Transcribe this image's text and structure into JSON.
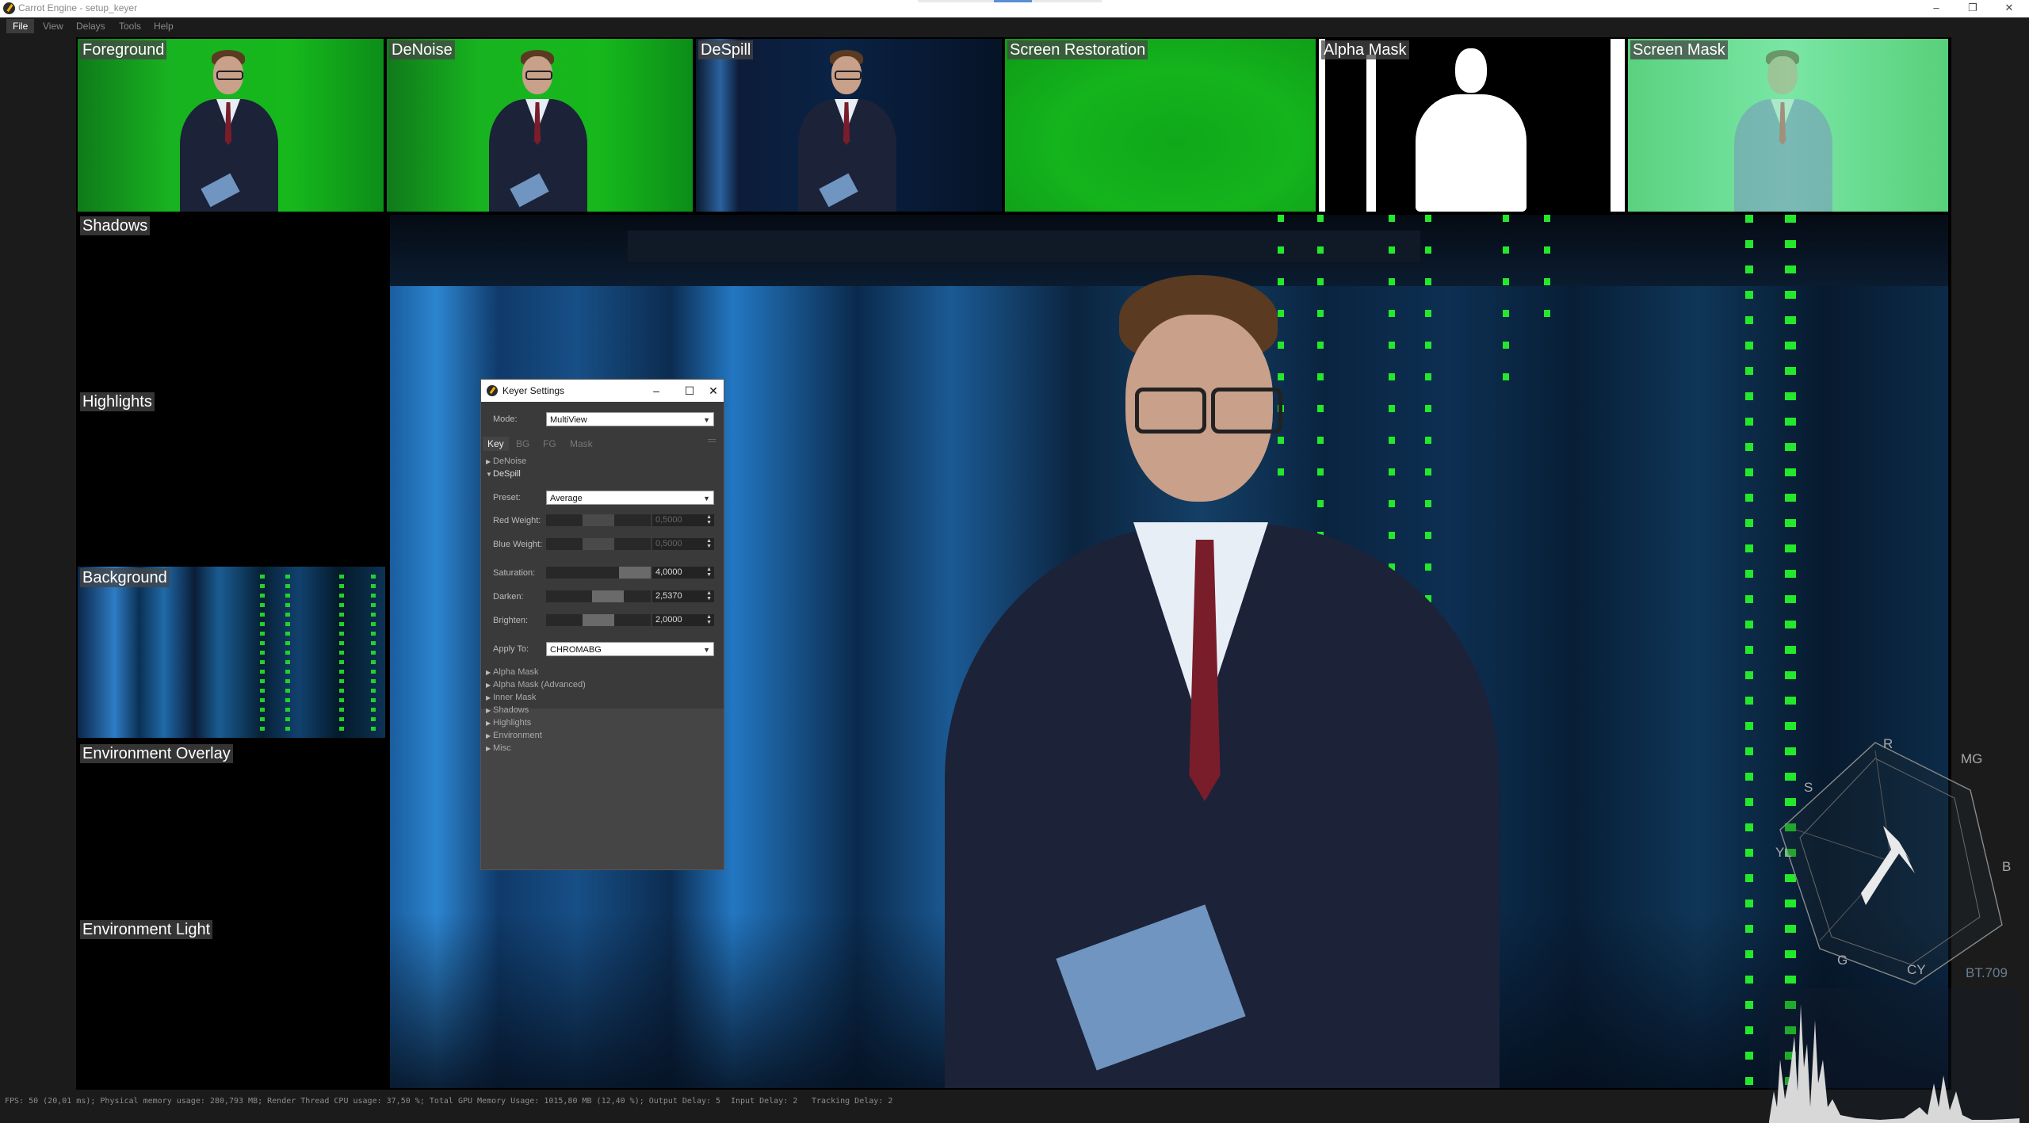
{
  "window": {
    "title": "Carrot Engine - setup_keyer",
    "controls": [
      "–",
      "❐",
      "✕"
    ]
  },
  "menubar": [
    "File",
    "View",
    "Delays",
    "Tools",
    "Help"
  ],
  "panels": {
    "foreground": "Foreground",
    "denoise": "DeNoise",
    "despill": "DeSpill",
    "screen_restoration": "Screen Restoration",
    "alpha_mask": "Alpha Mask",
    "screen_mask": "Screen Mask",
    "shadows": "Shadows",
    "highlights": "Highlights",
    "background": "Background",
    "environment_overlay": "Environment Overlay",
    "environment_light": "Environment Light"
  },
  "dialog": {
    "title": "Keyer Settings",
    "mode_label": "Mode:",
    "mode_value": "MultiView",
    "tabs": [
      "Key",
      "BG",
      "FG",
      "Mask"
    ],
    "tree_top": [
      "DeNoise",
      "DeSpill"
    ],
    "preset_label": "Preset:",
    "preset_value": "Average",
    "params": [
      {
        "label": "Red Weight:",
        "value": "0,5000",
        "fraction": 0.5,
        "enabled": false
      },
      {
        "label": "Blue Weight:",
        "value": "0,5000",
        "fraction": 0.5,
        "enabled": false
      },
      {
        "label": "Saturation:",
        "value": "4,0000",
        "fraction": 1.0,
        "enabled": true
      },
      {
        "label": "Darken:",
        "value": "2,5370",
        "fraction": 0.63,
        "enabled": true
      },
      {
        "label": "Brighten:",
        "value": "2,0000",
        "fraction": 0.5,
        "enabled": true
      }
    ],
    "apply_label": "Apply To:",
    "apply_value": "CHROMABG",
    "tree_bottom": [
      "Alpha Mask",
      "Alpha Mask (Advanced)",
      "Inner Mask",
      "Shadows",
      "Highlights",
      "Environment",
      "Misc"
    ]
  },
  "scope": {
    "labels": [
      "R",
      "MG",
      "B",
      "CY",
      "G",
      "YL",
      "S"
    ],
    "standard": "BT.709"
  },
  "statusbar": {
    "fps": "FPS: 50 (20,01 ms); Physical memory usage: 280,793 MB; Render Thread CPU usage: 37,50 %; Total GPU Memory Usage: 1015,80 MB (12,40 %); Output Delay: 5",
    "input_delay": "Input Delay: 2",
    "tracking_delay": "Tracking Delay: 2"
  },
  "colors": {
    "green_screen": "#16b81c",
    "studio_blue": "#1b6fb8",
    "led_green": "#1ee828",
    "suit": "#1c2238",
    "tie": "#7a1d2a"
  }
}
